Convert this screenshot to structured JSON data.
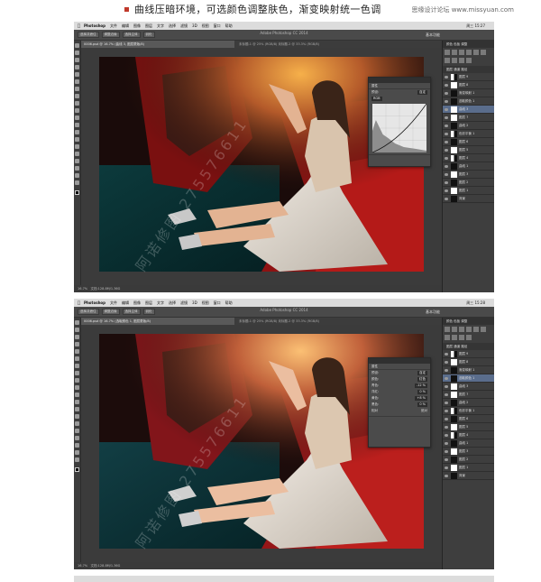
{
  "heading": "曲线压暗环境，可选颜色调整肤色，渐变映射统一色调",
  "site_watermark": "思缘设计论坛  www.missyuan.com",
  "photoshop": {
    "apple_icon": "apple-icon",
    "app_name": "Photoshop",
    "menu": [
      "文件",
      "编辑",
      "图像",
      "图层",
      "文字",
      "选择",
      "滤镜",
      "3D",
      "视图",
      "窗口",
      "帮助"
    ],
    "window_title": "Adobe Photoshop CC 2014",
    "workspace": "基本功能",
    "clock1": "周三 15:27",
    "clock2": "周三 15:28",
    "option_buttons": [
      "选择并遮住",
      "调整边缘",
      "选择主体",
      "羽化"
    ],
    "doc_tab1": "0006.psd @ 16.7% (曲线 3, 图层蒙版/8)",
    "doc_tab2": "0006.psd @ 16.7% (选取颜色 1, 图层蒙版/8)",
    "doc_tab_rest": "未标题-1 @ 25% (RGB/8)  未标题-2 @ 33.3% (RGB/8)",
    "status_zoom": "16.7%",
    "status_doc": "文档:128.8M/1.36G",
    "panel_tabs": "颜色  色板  调整",
    "layers_header": "图层  通道  路径",
    "layers": [
      {
        "name": "图层 9",
        "thumb": "half"
      },
      {
        "name": "图层 8",
        "thumb": "white"
      },
      {
        "name": "渐变映射 1",
        "thumb": "dark"
      },
      {
        "name": "选取颜色 1",
        "thumb": "dark"
      },
      {
        "name": "曲线 3",
        "thumb": "white"
      },
      {
        "name": "图层 7",
        "thumb": "white"
      },
      {
        "name": "曲线 2",
        "thumb": "dark"
      },
      {
        "name": "色彩平衡 1",
        "thumb": "half"
      },
      {
        "name": "图层 6",
        "thumb": "dark"
      },
      {
        "name": "图层 5",
        "thumb": "white"
      },
      {
        "name": "图层 4",
        "thumb": "half"
      },
      {
        "name": "曲线 1",
        "thumb": "dark"
      },
      {
        "name": "图层 3",
        "thumb": "white"
      },
      {
        "name": "图层 2",
        "thumb": "dark"
      },
      {
        "name": "图层 1",
        "thumb": "white"
      },
      {
        "name": "背景",
        "thumb": "dark"
      }
    ],
    "curves_panel": {
      "title": "属性",
      "preset_label": "预设:",
      "preset": "自定",
      "channel": "RGB"
    },
    "selective_panel": {
      "title": "属性",
      "preset_label": "预设:",
      "preset": "自定",
      "color_label": "颜色:",
      "color": "红色",
      "rows": [
        {
          "label": "青色:",
          "value": "-12 %"
        },
        {
          "label": "洋红:",
          "value": "0 %"
        },
        {
          "label": "黄色:",
          "value": "+8 %"
        },
        {
          "label": "黑色:",
          "value": "0 %"
        }
      ],
      "mode_relative": "相对",
      "mode_absolute": "绝对"
    }
  },
  "photo_watermark": "阿诺修图  275576611"
}
